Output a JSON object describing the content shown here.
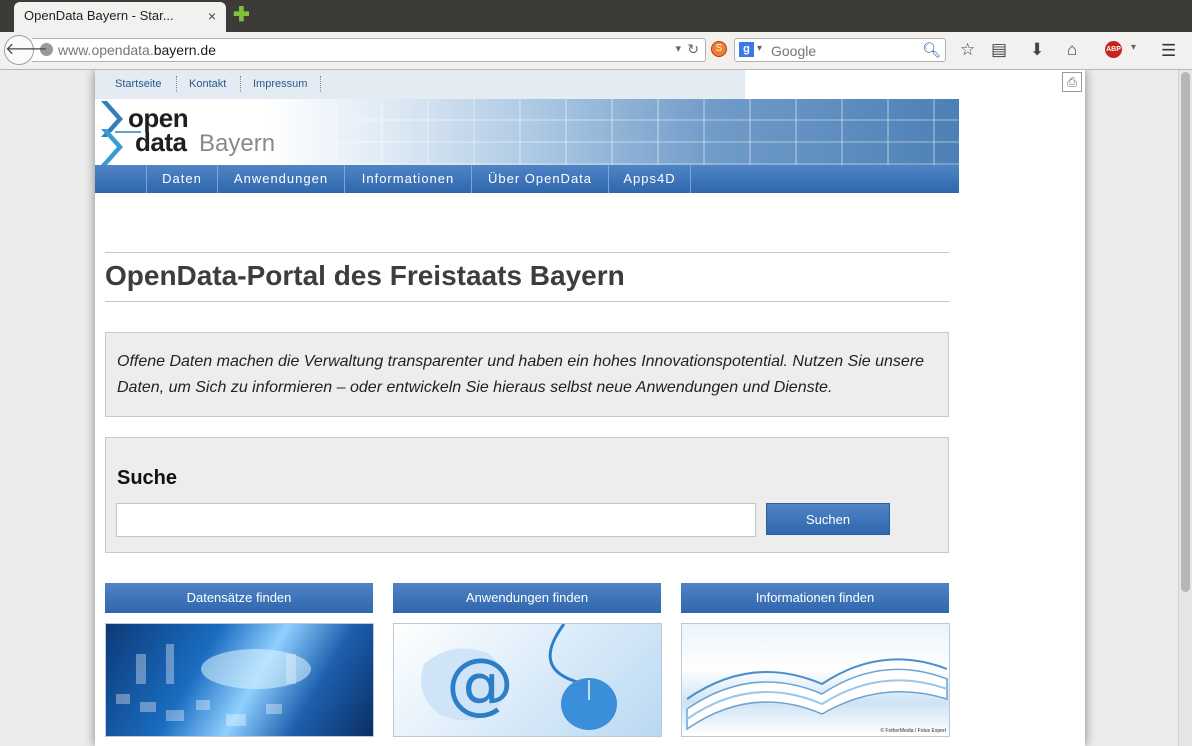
{
  "browser": {
    "tab_title": "OpenData Bayern - Star...",
    "tab_close": "×",
    "new_tab": "✚",
    "url_prefix": "www.opendata.",
    "url_domain": "bayern.de",
    "search_engine_badge": "g",
    "search_placeholder": "Google"
  },
  "page": {
    "meta_nav": [
      "Startseite",
      "Kontakt",
      "Impressum"
    ],
    "logo": {
      "line1": "open",
      "line2": "data",
      "line3": "Bayern"
    },
    "main_nav": [
      "Daten",
      "Anwendungen",
      "Informationen",
      "Über OpenData",
      "Apps4D"
    ],
    "title": "OpenData-Portal des Freistaats Bayern",
    "intro": "Offene Daten machen die Verwaltung transparenter und haben ein hohes Innovationspotential. Nutzen Sie unsere Daten, um Sich zu informieren – oder entwickeln Sie hieraus selbst neue Anwendungen und Dienste.",
    "search": {
      "heading": "Suche",
      "value": "",
      "button": "Suchen"
    },
    "columns": [
      {
        "button": "Datensätze finden"
      },
      {
        "button": "Anwendungen finden"
      },
      {
        "button": "Informationen finden"
      }
    ],
    "image_credit": "© FotherMedia / Fotus Expert"
  },
  "colors": {
    "accent_blue": "#2f67ad",
    "meta_nav_bg": "#e4ebf3",
    "box_bg": "#ededed"
  }
}
